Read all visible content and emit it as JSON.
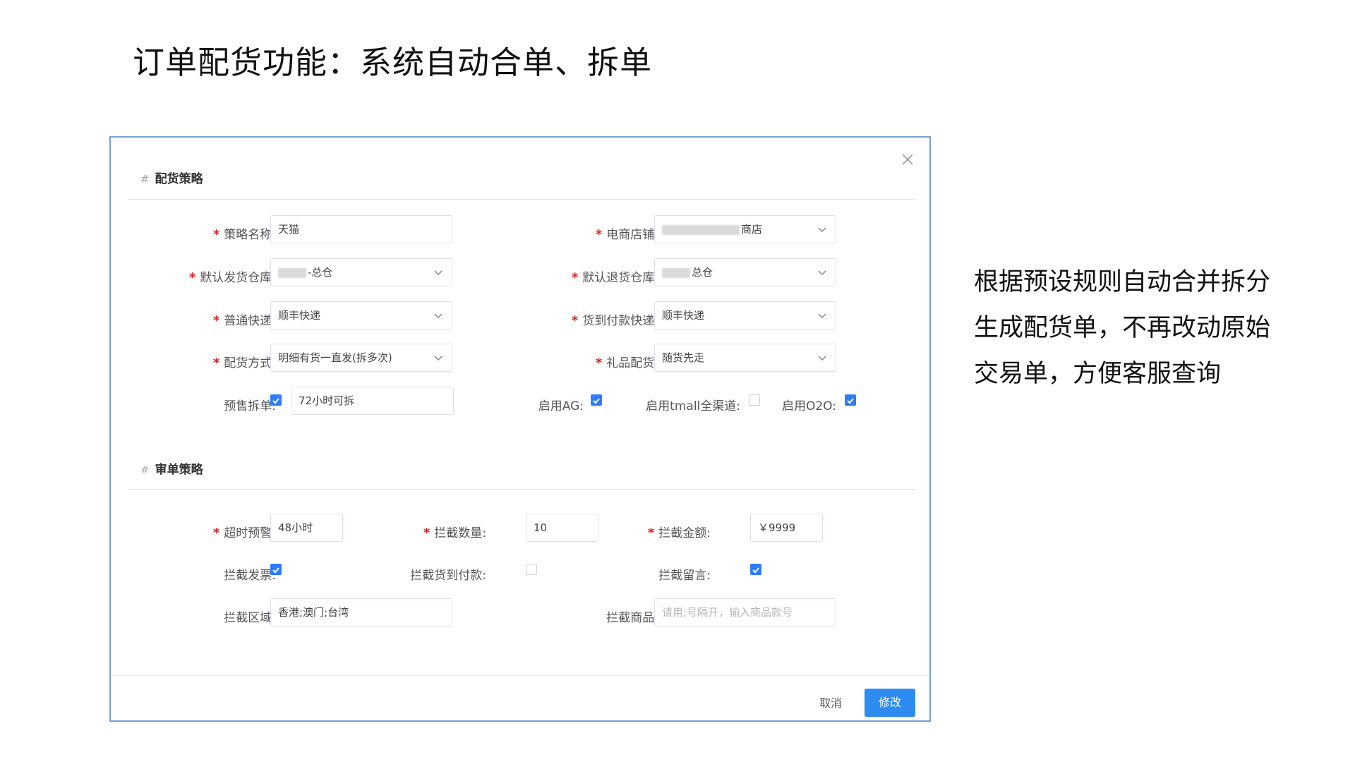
{
  "slide": {
    "title": "订单配货功能：系统自动合单、拆单",
    "note_lines": [
      "根据预设规则自动合并拆分",
      "生成配货单，不再改动原始",
      "交易单，方便客服查询"
    ]
  },
  "dialog": {
    "section1": "配货策略",
    "section2": "审单策略",
    "fields": {
      "strategy_name": {
        "label": "策略名称:",
        "value": "天猫"
      },
      "shop": {
        "label": "电商店铺:",
        "value_suffix": "商店"
      },
      "default_ship_wh": {
        "label": "默认发货仓库:",
        "value_suffix": "-总仓"
      },
      "default_return_wh": {
        "label": "默认退货仓库:",
        "value_suffix": "总仓"
      },
      "normal_express": {
        "label": "普通快递:",
        "value": "顺丰快递"
      },
      "cod_express": {
        "label": "货到付款快递:",
        "value": "顺丰快递"
      },
      "alloc_method": {
        "label": "配货方式:",
        "value": "明细有货一直发(拆多次)"
      },
      "gift_alloc": {
        "label": "礼品配货:",
        "value": "随货先走"
      },
      "presale_split": {
        "label": "预售拆单:",
        "value": "72小时可拆",
        "checked": true
      },
      "enable_ag": {
        "label": "启用AG:",
        "checked": true
      },
      "enable_tmall": {
        "label": "启用tmall全渠道:",
        "checked": false
      },
      "enable_o2o": {
        "label": "启用O2O:",
        "checked": true
      },
      "timeout_warn": {
        "label": "超时预警:",
        "value": "48小时"
      },
      "intercept_qty": {
        "label": "拦截数量:",
        "value": "10"
      },
      "intercept_amount": {
        "label": "拦截金额:",
        "value": "￥9999"
      },
      "intercept_invoice": {
        "label": "拦截发票:",
        "checked": true
      },
      "intercept_cod": {
        "label": "拦截货到付款:",
        "checked": false
      },
      "intercept_message": {
        "label": "拦截留言:",
        "checked": true
      },
      "intercept_region": {
        "label": "拦截区域:",
        "value": "香港;澳门;台湾"
      },
      "intercept_goods": {
        "label": "拦截商品:",
        "placeholder": "请用;号隔开，输入商品款号"
      }
    },
    "buttons": {
      "cancel": "取消",
      "confirm": "修改"
    }
  },
  "colors": {
    "primary": "#2e8cf0",
    "required": "#e02020",
    "dialog_border": "#7a9fd4"
  }
}
